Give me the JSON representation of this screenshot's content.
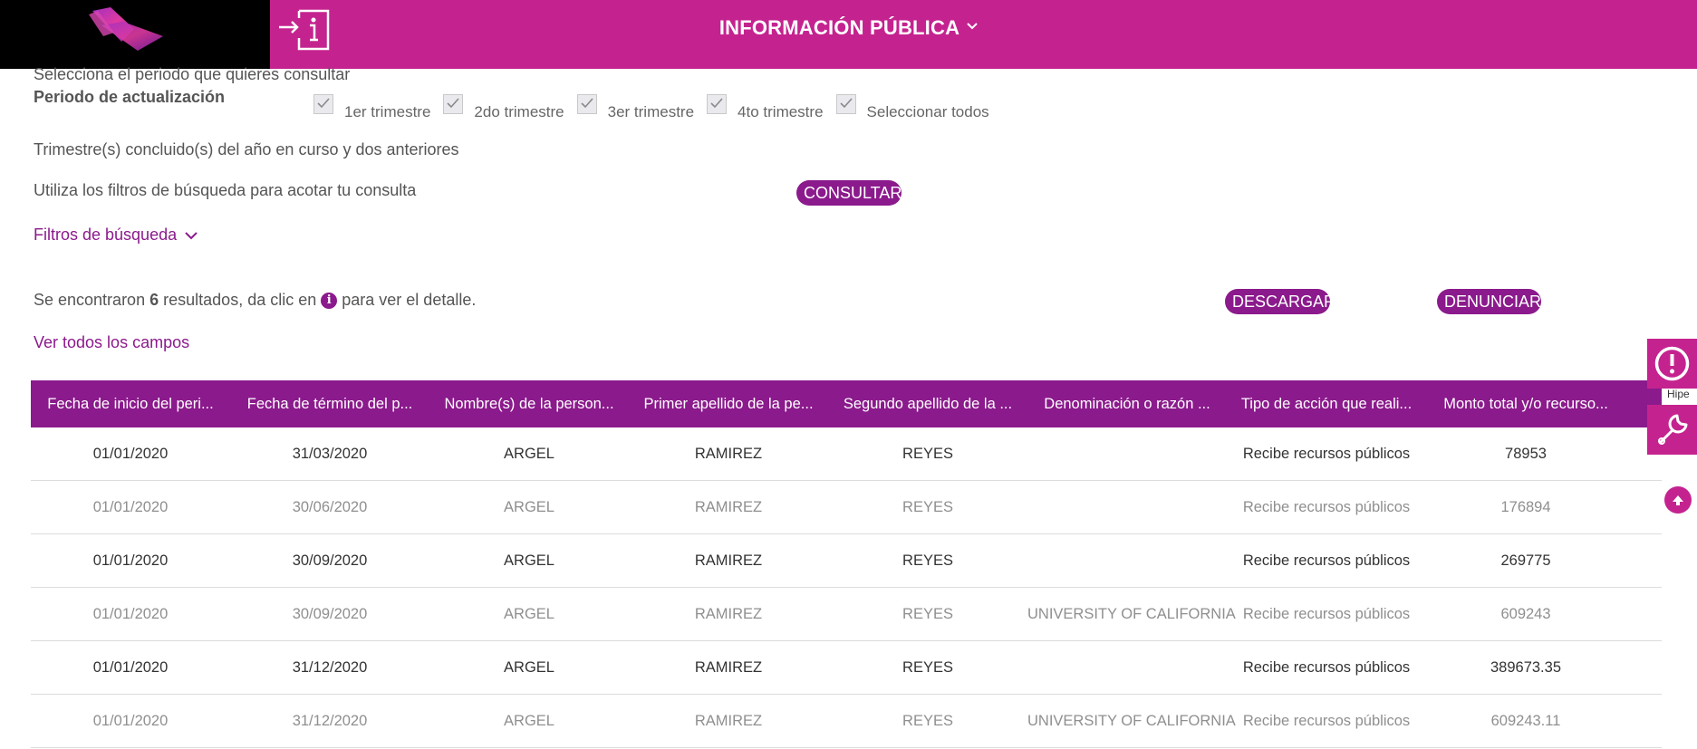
{
  "header": {
    "title": "INFORMACIÓN PÚBLICA"
  },
  "periodo": {
    "prompt": "Selecciona el periodo que quieres consultar",
    "label": "Periodo de actualización",
    "options": [
      {
        "label": "1er trimestre",
        "checked": true
      },
      {
        "label": "2do trimestre",
        "checked": true
      },
      {
        "label": "3er trimestre",
        "checked": true
      },
      {
        "label": "4to trimestre",
        "checked": true
      },
      {
        "label": "Seleccionar todos",
        "checked": true
      }
    ],
    "note": "Trimestre(s) concluido(s) del año en curso y dos anteriores"
  },
  "filters": {
    "prompt": "Utiliza los filtros de búsqueda para acotar tu consulta",
    "consult_label": "CONSULTAR",
    "toggle_label": "Filtros de búsqueda"
  },
  "results": {
    "prefix": "Se encontraron",
    "count": "6",
    "middle": "resultados, da clic en",
    "suffix": "para ver el detalle.",
    "download_label": "DESCARGAR",
    "report_label": "DENUNCIAR",
    "all_fields_label": "Ver todos los campos"
  },
  "side": {
    "partial_label": "Hipe"
  },
  "table": {
    "headers": [
      "Fecha de inicio del peri...",
      "Fecha de término del p...",
      "Nombre(s) de la person...",
      "Primer apellido de la pe...",
      "Segundo apellido de la ...",
      "Denominación o razón ...",
      "Tipo de acción que reali...",
      "Monto total y/o recurso..."
    ],
    "rows": [
      [
        "01/01/2020",
        "31/03/2020",
        "ARGEL",
        "RAMIREZ",
        "REYES",
        "",
        "Recibe recursos públicos",
        "78953"
      ],
      [
        "01/01/2020",
        "30/06/2020",
        "ARGEL",
        "RAMIREZ",
        "REYES",
        "",
        "Recibe recursos públicos",
        "176894"
      ],
      [
        "01/01/2020",
        "30/09/2020",
        "ARGEL",
        "RAMIREZ",
        "REYES",
        "",
        "Recibe recursos públicos",
        "269775"
      ],
      [
        "01/01/2020",
        "30/09/2020",
        "ARGEL",
        "RAMIREZ",
        "REYES",
        "UNIVERSITY OF CALIFORNIA",
        "Recibe recursos públicos",
        "609243"
      ],
      [
        "01/01/2020",
        "31/12/2020",
        "ARGEL",
        "RAMIREZ",
        "REYES",
        "",
        "Recibe recursos públicos",
        "389673.35"
      ],
      [
        "01/01/2020",
        "31/12/2020",
        "ARGEL",
        "RAMIREZ",
        "REYES",
        "UNIVERSITY OF CALIFORNIA",
        "Recibe recursos públicos",
        "609243.11"
      ]
    ]
  },
  "colors": {
    "brand_pink": "#c4238f",
    "brand_purple": "#8b1a8c"
  }
}
